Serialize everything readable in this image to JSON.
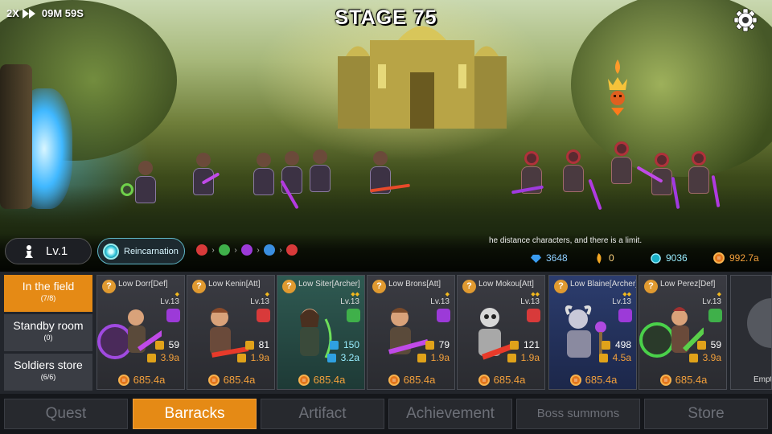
{
  "hud": {
    "speed": "2X",
    "timer": "09M 59S",
    "stage_title": "STAGE 75"
  },
  "status": {
    "level": "Lv.1",
    "reincarnation_label": "Reincarnation",
    "element_cycle": [
      "fire",
      "nature",
      "dark",
      "water",
      "fire"
    ],
    "marquee": "he distance characters, and there is a limit."
  },
  "resources": {
    "diamonds": "3648",
    "feathers": "0",
    "crystals": "9036",
    "gold": "992.7a"
  },
  "side_menu": [
    {
      "label": "In the field",
      "count": "(7/8)"
    },
    {
      "label": "Standby room",
      "count": "(0)"
    },
    {
      "label": "Soldiers store",
      "count": "(6/6)"
    }
  ],
  "cards": [
    {
      "name": "Low Dorr[Def]",
      "stars": "◆",
      "level": "Lv.13",
      "element": "dark",
      "stat1": "59",
      "stat2": "3.9a",
      "price": "685.4a"
    },
    {
      "name": "Low Kenin[Att]",
      "stars": "◆",
      "level": "Lv.13",
      "element": "fire",
      "stat1": "81",
      "stat2": "1.9a",
      "price": "685.4a"
    },
    {
      "name": "Low Siter[Archer]",
      "stars": "◆◆",
      "level": "Lv.13",
      "element": "nature",
      "stat1": "150",
      "stat2": "3.2a",
      "price": "685.4a"
    },
    {
      "name": "Low Brons[Att]",
      "stars": "◆",
      "level": "Lv.13",
      "element": "dark",
      "stat1": "79",
      "stat2": "1.9a",
      "price": "685.4a"
    },
    {
      "name": "Low Mokou[Att]",
      "stars": "◆◆",
      "level": "Lv.13",
      "element": "fire",
      "stat1": "121",
      "stat2": "1.9a",
      "price": "685.4a"
    },
    {
      "name": "Low Blaine[Archer]",
      "stars": "◆◆",
      "level": "Lv.13",
      "element": "dark",
      "stat1": "498",
      "stat2": "4.5a",
      "price": "685.4a"
    },
    {
      "name": "Low Perez[Def]",
      "stars": "◆",
      "level": "Lv.13",
      "element": "nature",
      "stat1": "59",
      "stat2": "3.9a",
      "price": "685.4a"
    }
  ],
  "empty_slot_label": "Empt",
  "tabs": [
    "Quest",
    "Barracks",
    "Artifact",
    "Achievement",
    "Boss summons",
    "Store"
  ],
  "active_tab": "Barracks",
  "colors": {
    "accent": "#e58a15",
    "fire": "#d83a3a",
    "nature": "#3fb04a",
    "dark": "#9c3ad8",
    "water": "#3a8ee0"
  }
}
